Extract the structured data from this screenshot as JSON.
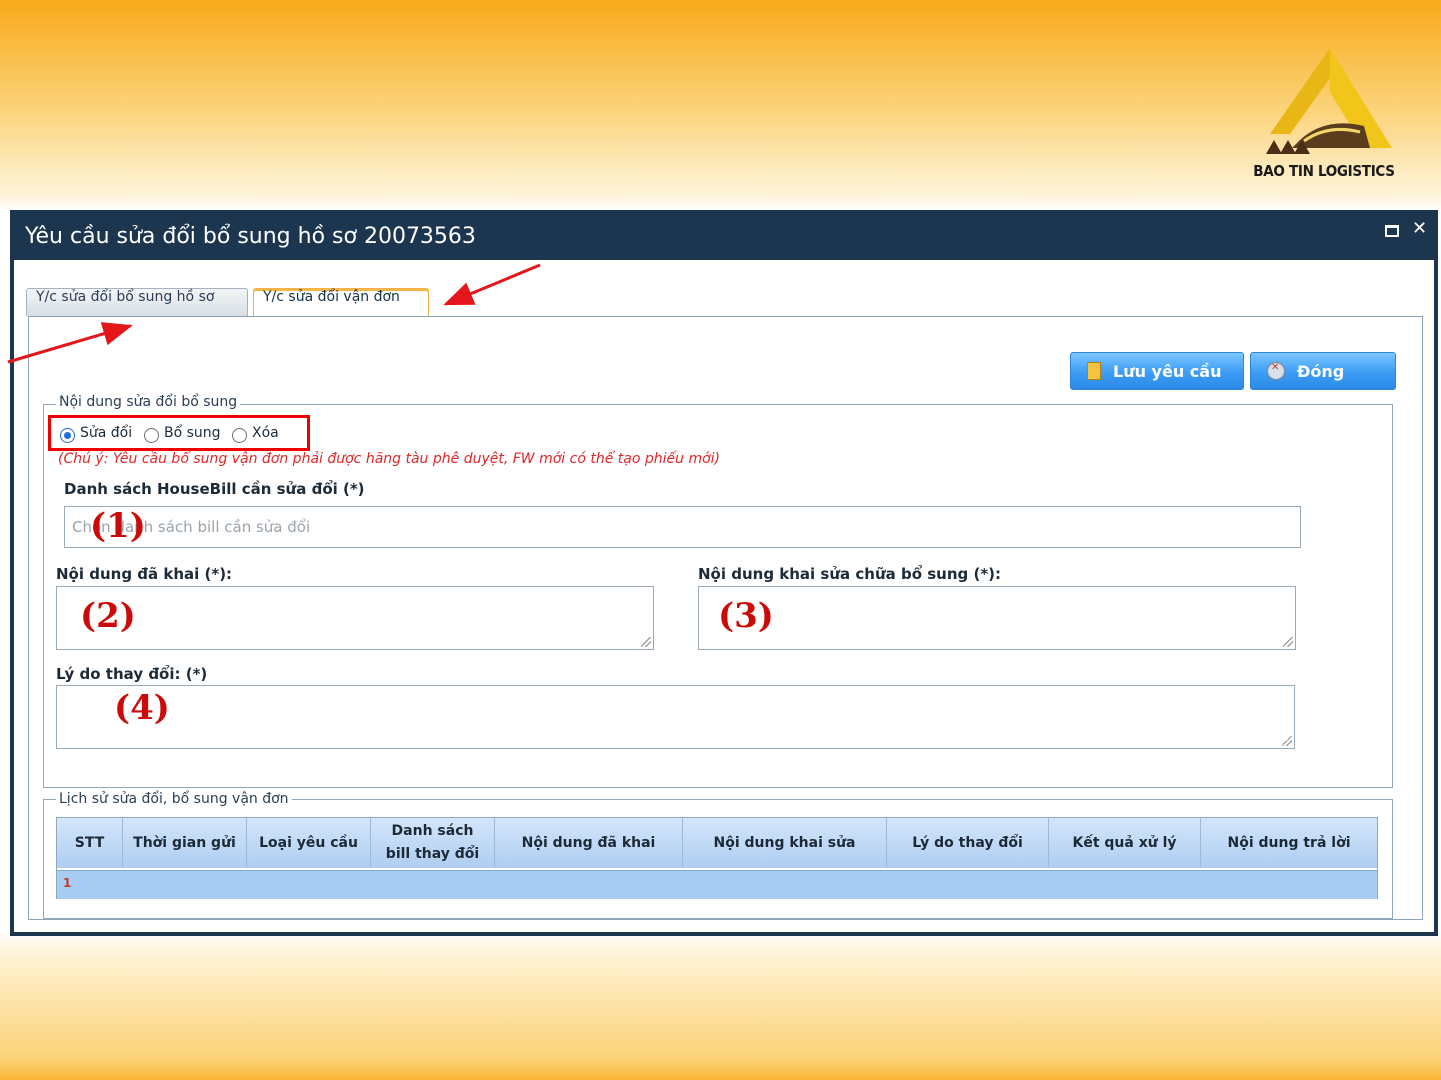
{
  "brand": {
    "logo_text": "BAO TIN LOGISTICS"
  },
  "window": {
    "title": "Yêu cầu sửa đổi bổ sung hồ sơ 20073563",
    "maximize_icon": "maximize-icon",
    "close_icon": "close-icon"
  },
  "tabs": [
    {
      "label": "Y/c sửa đổi bổ sung hồ sơ",
      "active": false
    },
    {
      "label": "Y/c sửa đổi vận đơn",
      "active": true
    }
  ],
  "toolbar": {
    "save_label": "Lưu yêu cầu",
    "close_label": "Đóng"
  },
  "form": {
    "legend": "Nội dung sửa đổi bổ sung",
    "radios": [
      {
        "label": "Sửa đổi",
        "checked": true
      },
      {
        "label": "Bổ sung",
        "checked": false
      },
      {
        "label": "Xóa",
        "checked": false
      }
    ],
    "note": "(Chú ý: Yêu cầu bổ sung vận đơn phải được hãng tàu phê duyệt, FW mới có thể tạo phiếu mới)",
    "housebill_label": "Danh sách HouseBill cần sửa đổi (*)",
    "housebill_placeholder": "Chọn danh sách bill cần sửa đổi",
    "declared_label": "Nội dung đã khai (*):",
    "amend_label": "Nội dung khai sửa chữa bổ sung (*):",
    "reason_label": "Lý do thay đổi: (*)"
  },
  "annotations": {
    "n1": "(1)",
    "n2": "(2)",
    "n3": "(3)",
    "n4": "(4)"
  },
  "history": {
    "legend": "Lịch sử sửa đổi, bổ sung vận đơn",
    "columns": [
      "STT",
      "Thời gian gửi",
      "Loại yêu cầu",
      "Danh sách bill thay đổi",
      "Nội dung đã khai",
      "Nội dung khai sửa",
      "Lý do thay đổi",
      "Kết quả xử lý",
      "Nội dung trả lời"
    ],
    "rows": [
      {
        "stt": "1"
      }
    ]
  },
  "colors": {
    "accent_red": "#e00000",
    "title_bar": "#1d3650",
    "button_blue": "#3c9cf4",
    "background_orange": "#f9a91a"
  }
}
